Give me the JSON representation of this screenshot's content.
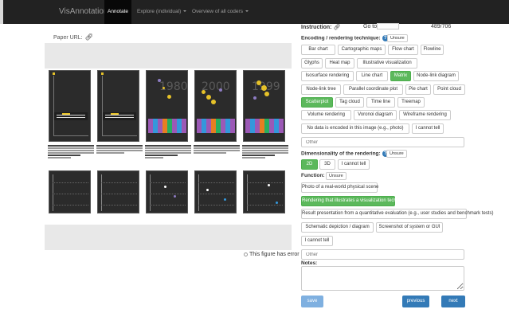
{
  "nav": {
    "brand": "VisAnnotation",
    "annotate": "Annotate",
    "explore": "Explore (individual)",
    "overview": "Overview of all coders"
  },
  "left": {
    "paper_url_label": "Paper URL:",
    "link_icon": "link-icon",
    "years": [
      "1980",
      "2000",
      "1999"
    ],
    "error_label": "This figure has error"
  },
  "header": {
    "instruction_label": "Instruction:",
    "goto_label": "Go to",
    "goto_value": "",
    "counter": "489/706"
  },
  "encoding": {
    "label": "Encoding / rendering technique:",
    "help": "?",
    "unsure": "Unsure",
    "options": [
      {
        "label": "Bar chart",
        "selected": false
      },
      {
        "label": "Cartographic maps",
        "selected": false
      },
      {
        "label": "Flow chart",
        "selected": false
      },
      {
        "label": "Flowline",
        "selected": false
      },
      {
        "label": "Glyphs",
        "selected": false
      },
      {
        "label": "Heat map",
        "selected": false
      },
      {
        "label": "Illustrative visualization",
        "selected": false
      },
      {
        "label": "Isosurface rendering",
        "selected": false
      },
      {
        "label": "Line chart",
        "selected": false
      },
      {
        "label": "Matrix",
        "selected": true
      },
      {
        "label": "Node-link diagram",
        "selected": false
      },
      {
        "label": "Node-link tree",
        "selected": false
      },
      {
        "label": "Parallel coordinate plot",
        "selected": false
      },
      {
        "label": "Pie chart",
        "selected": false
      },
      {
        "label": "Point cloud",
        "selected": false
      },
      {
        "label": "Scatterplot",
        "selected": true
      },
      {
        "label": "Tag cloud",
        "selected": false
      },
      {
        "label": "Time line",
        "selected": false
      },
      {
        "label": "Treemap",
        "selected": false
      },
      {
        "label": "Volume rendering",
        "selected": false
      },
      {
        "label": "Voronoi diagram",
        "selected": false
      },
      {
        "label": "Wireframe rendering",
        "selected": false
      },
      {
        "label": "No data is encoded in this image (e.g., photo)",
        "selected": false
      },
      {
        "label": "I cannot tell",
        "selected": false
      }
    ],
    "other_placeholder": "Other"
  },
  "dimensionality": {
    "label": "Dimensionality of the rendering:",
    "help": "?",
    "unsure": "Unsure",
    "options": [
      {
        "label": "2D",
        "selected": true
      },
      {
        "label": "3D",
        "selected": false
      },
      {
        "label": "I cannot tell",
        "selected": false
      }
    ]
  },
  "function": {
    "label": "Function:",
    "unsure": "Unsure",
    "options": [
      {
        "label": "Photo of a real-world physical scene",
        "selected": false
      },
      {
        "label": "Rendering that illustrates a visualization technique",
        "selected": true
      },
      {
        "label": "Result presentation from a quantitative evaluation (e.g., user studies and benchmark tests)",
        "selected": false
      },
      {
        "label": "Schematic depiction / diagram",
        "selected": false
      },
      {
        "label": "Screenshot of system or GUI",
        "selected": false
      },
      {
        "label": "I cannot tell",
        "selected": false
      }
    ],
    "other_placeholder": "Other"
  },
  "notes": {
    "label": "Notes:",
    "value": ""
  },
  "actions": {
    "save": "save",
    "previous": "previous",
    "next": "next"
  },
  "colors": {
    "navbar": "#222222",
    "selected": "#5cb85c",
    "primary": "#337ab7"
  }
}
